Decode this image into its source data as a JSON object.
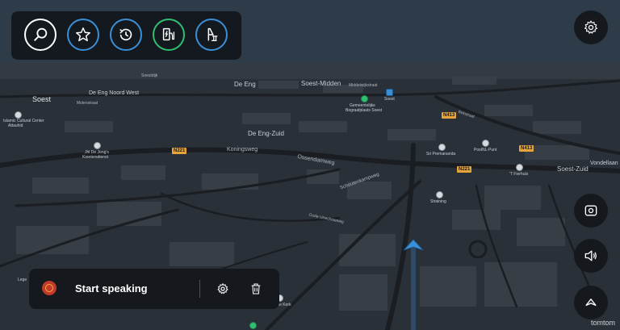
{
  "toolbar": {
    "buttons": [
      {
        "icon": "search-icon",
        "color": "#ffffff"
      },
      {
        "icon": "star-icon",
        "color": "#3b8fd6"
      },
      {
        "icon": "history-icon",
        "color": "#3b8fd6"
      },
      {
        "icon": "ev-charging-icon",
        "color": "#2fbf71"
      },
      {
        "icon": "parking-icon",
        "color": "#3b8fd6"
      }
    ]
  },
  "voice": {
    "label": "Start speaking"
  },
  "map": {
    "labels": {
      "soest": "Soest",
      "soest_midden": "Soest-Midden",
      "soest_zuid": "Soest-Zuid",
      "vondellaan": "Vondellaan",
      "de_eng": "De Eng",
      "de_eng_noord_west": "De Eng Noord West",
      "de_eng_zuid": "De Eng-Zuid",
      "koningsweg": "Koningsweg",
      "ossendamweg": "Ossendamweg",
      "schoutenkampweg": "Schoutenkampweg",
      "oude_utrechtseweg": "Oude Utrechtseweg",
      "birkstraat": "Birkstraat",
      "middelwijkstraat": "Middelwijkstraat",
      "molenstraat": "Molenstraat",
      "soestdijk": "Soestdijk",
      "islamic_center": "Islamic Cultural Center",
      "attauhid": "Attauhid",
      "jhi_de_jong": "Jhl De Jong's",
      "koeriersdienst": "Koeriersdienst",
      "begraafplaats_1": "Gemeentelijke",
      "begraafplaats_2": "Begraafplaats Soest",
      "soest_station": "Soest",
      "sri_premananda": "Sri Premananda",
      "postnl": "PostNL-Punt",
      "fierhuis": "'T Fierhuis",
      "straining": "Straining",
      "kerk": "Lille Kerk",
      "lege": "Lege"
    },
    "shields": {
      "n221_a": "N221",
      "n221_b": "N221",
      "n413": "N413",
      "n413_b": "N413"
    }
  },
  "brand": "tomtom",
  "colors": {
    "panel": "#15191e",
    "accent_blue": "#3b8fd6",
    "accent_green": "#2fbf71",
    "nav_arrow": "#3b8fd6"
  }
}
